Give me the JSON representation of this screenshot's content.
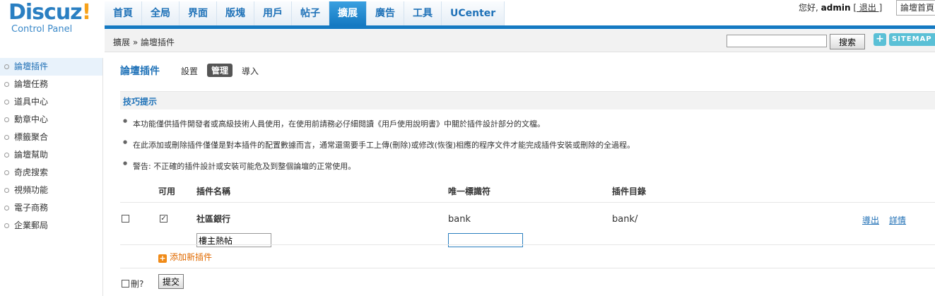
{
  "logo": {
    "main": "Discuz",
    "bang": "!",
    "sub": "Control Panel"
  },
  "nav": [
    {
      "label": "首頁"
    },
    {
      "label": "全局"
    },
    {
      "label": "界面"
    },
    {
      "label": "版塊"
    },
    {
      "label": "用戶"
    },
    {
      "label": "帖子"
    },
    {
      "label": "擴展"
    },
    {
      "label": "廣告"
    },
    {
      "label": "工具"
    },
    {
      "label": "UCenter"
    }
  ],
  "user": {
    "greeting": "您好,",
    "name": "admin",
    "logout": "[ 退出 ]",
    "home_select": "論壇首頁"
  },
  "breadcrumb": "擴展 » 論壇插件",
  "search": {
    "value": "",
    "button": "搜索"
  },
  "sitemap": {
    "plus": "+",
    "label": "SITEMAP"
  },
  "sidebar": {
    "items": [
      {
        "label": "論壇插件"
      },
      {
        "label": "論壇任務"
      },
      {
        "label": "道具中心"
      },
      {
        "label": "勳章中心"
      },
      {
        "label": "標籤聚合"
      },
      {
        "label": "論壇幫助"
      },
      {
        "label": "奇虎搜索"
      },
      {
        "label": "視頻功能"
      },
      {
        "label": "電子商務"
      },
      {
        "label": "企業郵局"
      }
    ]
  },
  "main": {
    "title": "論壇插件",
    "tabs": {
      "settings": "設置",
      "manage": "管理",
      "import": "導入"
    },
    "tips_title": "技巧提示",
    "tips": [
      "本功能僅供插件開發者或高級技術人員使用，在使用前請務必仔細閱讀《用戶使用說明書》中關於插件設計部分的文檔。",
      "在此添加或刪除插件僅僅是對本插件的配置數據而言，通常還需要手工上傳(刪除)或修改(恢復)相應的程序文件才能完成插件安裝或刪除的全過程。",
      "警告: 不正確的插件設計或安裝可能危及到整個論壇的正常使用。"
    ]
  },
  "table": {
    "headers": {
      "enabled": "可用",
      "name": "插件名稱",
      "identifier": "唯一標識符",
      "directory": "插件目錄"
    },
    "rows": [
      {
        "name": "社區銀行",
        "identifier": "bank",
        "directory": "bank/",
        "enabled": true,
        "export": "導出",
        "details": "詳情"
      }
    ],
    "new_row": {
      "name_value": "樓主熱帖",
      "identifier_value": ""
    },
    "add_plugin": "添加新插件",
    "delete_label": "刪?",
    "submit": "提交",
    "checkmark": "✓"
  }
}
